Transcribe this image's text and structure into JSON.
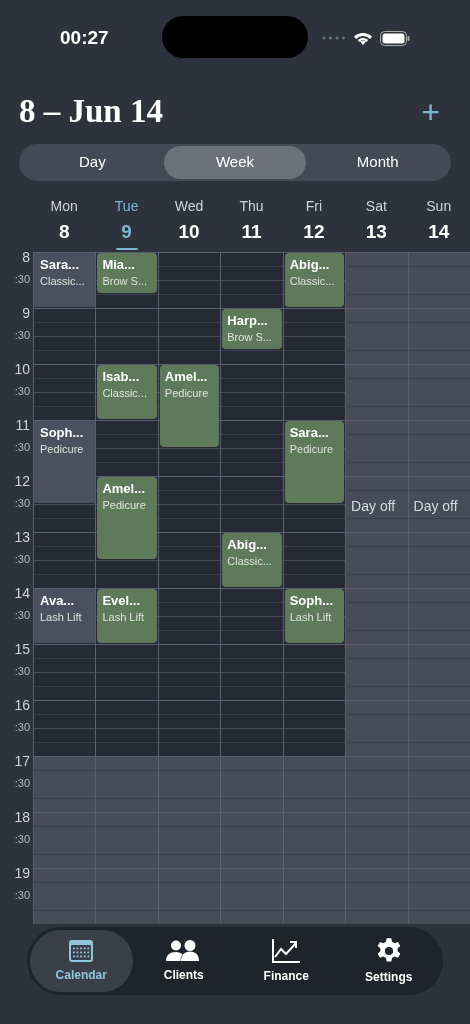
{
  "status_bar": {
    "time": "00:27"
  },
  "header": {
    "title": "8 – Jun 14",
    "add_label": "+"
  },
  "view_tabs": [
    {
      "label": "Day",
      "selected": false
    },
    {
      "label": "Week",
      "selected": true
    },
    {
      "label": "Month",
      "selected": false
    }
  ],
  "days": [
    {
      "name": "Mon",
      "date": "8",
      "today": false,
      "day_off": false
    },
    {
      "name": "Tue",
      "date": "9",
      "today": true,
      "day_off": false
    },
    {
      "name": "Wed",
      "date": "10",
      "today": false,
      "day_off": false
    },
    {
      "name": "Thu",
      "date": "11",
      "today": false,
      "day_off": false
    },
    {
      "name": "Fri",
      "date": "12",
      "today": false,
      "day_off": false
    },
    {
      "name": "Sat",
      "date": "13",
      "today": false,
      "day_off": true,
      "note": "Day off"
    },
    {
      "name": "Sun",
      "date": "14",
      "today": false,
      "day_off": true,
      "note": "Day off"
    }
  ],
  "hours": [
    {
      "hour": "8",
      "half": ":30",
      "closed": false,
      "cells": [
        {
          "kind": "hour",
          "client": "Sara...",
          "service": "Classic...",
          "past": true
        },
        {
          "kind": "short",
          "client": "Mia...",
          "service": "Brow S...",
          "past": false
        },
        {
          "kind": "empty"
        },
        {
          "kind": "empty"
        },
        {
          "kind": "hour",
          "client": "Abig...",
          "service": "Classic...",
          "past": false
        },
        {
          "kind": "empty"
        },
        {
          "kind": "empty"
        }
      ]
    },
    {
      "hour": "9",
      "half": ":30",
      "closed": false,
      "cells": [
        {
          "kind": "empty"
        },
        {
          "kind": "empty"
        },
        {
          "kind": "empty"
        },
        {
          "kind": "short",
          "client": "Harp...",
          "service": "Brow S...",
          "past": false
        },
        {
          "kind": "empty"
        },
        {
          "kind": "empty"
        },
        {
          "kind": "empty"
        }
      ]
    },
    {
      "hour": "10",
      "half": ":30",
      "closed": false,
      "cells": [
        {
          "kind": "empty"
        },
        {
          "kind": "hour",
          "client": "Isab...",
          "service": "Classic...",
          "past": false
        },
        {
          "kind": "long",
          "client": "Amel...",
          "service": "Pedicure",
          "past": false
        },
        {
          "kind": "empty"
        },
        {
          "kind": "empty"
        },
        {
          "kind": "empty"
        },
        {
          "kind": "empty"
        }
      ]
    },
    {
      "hour": "11",
      "half": ":30",
      "closed": false,
      "cells": [
        {
          "kind": "long",
          "client": "Soph...",
          "service": "Pedicure",
          "past": true
        },
        {
          "kind": "empty"
        },
        {
          "kind": "empty"
        },
        {
          "kind": "empty"
        },
        {
          "kind": "long",
          "client": "Sara...",
          "service": "Pedicure",
          "past": false
        },
        {
          "kind": "empty"
        },
        {
          "kind": "empty"
        }
      ]
    },
    {
      "hour": "12",
      "half": ":30",
      "closed": false,
      "cells": [
        {
          "kind": "empty"
        },
        {
          "kind": "long",
          "client": "Amel...",
          "service": "Pedicure",
          "past": false
        },
        {
          "kind": "empty"
        },
        {
          "kind": "empty"
        },
        {
          "kind": "empty"
        },
        {
          "kind": "empty"
        },
        {
          "kind": "empty"
        }
      ]
    },
    {
      "hour": "13",
      "half": ":30",
      "closed": false,
      "cells": [
        {
          "kind": "empty"
        },
        {
          "kind": "empty"
        },
        {
          "kind": "empty"
        },
        {
          "kind": "hour",
          "client": "Abig...",
          "service": "Classic...",
          "past": false
        },
        {
          "kind": "empty"
        },
        {
          "kind": "empty"
        },
        {
          "kind": "empty"
        }
      ]
    },
    {
      "hour": "14",
      "half": ":30",
      "closed": false,
      "cells": [
        {
          "kind": "hour",
          "client": "Ava...",
          "service": "Lash Lift",
          "past": true
        },
        {
          "kind": "hour",
          "client": "Evel...",
          "service": "Lash Lift",
          "past": false
        },
        {
          "kind": "empty"
        },
        {
          "kind": "empty"
        },
        {
          "kind": "hour",
          "client": "Soph...",
          "service": "Lash Lift",
          "past": false
        },
        {
          "kind": "empty"
        },
        {
          "kind": "empty"
        }
      ]
    },
    {
      "hour": "15",
      "half": ":30",
      "closed": false,
      "cells": [
        {
          "kind": "empty"
        },
        {
          "kind": "empty"
        },
        {
          "kind": "empty"
        },
        {
          "kind": "empty"
        },
        {
          "kind": "empty"
        },
        {
          "kind": "empty"
        },
        {
          "kind": "empty"
        }
      ]
    },
    {
      "hour": "16",
      "half": ":30",
      "closed": false,
      "cells": [
        {
          "kind": "empty"
        },
        {
          "kind": "empty"
        },
        {
          "kind": "empty"
        },
        {
          "kind": "empty"
        },
        {
          "kind": "empty"
        },
        {
          "kind": "empty"
        },
        {
          "kind": "empty"
        }
      ]
    },
    {
      "hour": "17",
      "half": ":30",
      "closed": true,
      "cells": [
        {
          "kind": "empty"
        },
        {
          "kind": "empty"
        },
        {
          "kind": "empty"
        },
        {
          "kind": "empty"
        },
        {
          "kind": "empty"
        },
        {
          "kind": "empty"
        },
        {
          "kind": "empty"
        }
      ]
    },
    {
      "hour": "18",
      "half": ":30",
      "closed": true,
      "cells": [
        {
          "kind": "empty"
        },
        {
          "kind": "empty"
        },
        {
          "kind": "empty"
        },
        {
          "kind": "empty"
        },
        {
          "kind": "empty"
        },
        {
          "kind": "empty"
        },
        {
          "kind": "empty"
        }
      ]
    },
    {
      "hour": "19",
      "half": ":30",
      "closed": true,
      "cells": [
        {
          "kind": "empty"
        },
        {
          "kind": "empty"
        },
        {
          "kind": "empty"
        },
        {
          "kind": "empty"
        },
        {
          "kind": "empty"
        },
        {
          "kind": "empty"
        },
        {
          "kind": "empty"
        }
      ]
    }
  ],
  "tab_bar": [
    {
      "label": "Calendar",
      "kind": "calendar",
      "selected": true
    },
    {
      "label": "Clients",
      "kind": "clients",
      "selected": false
    },
    {
      "label": "Finance",
      "kind": "finance",
      "selected": false
    },
    {
      "label": "Settings",
      "kind": "settings",
      "selected": false
    }
  ]
}
